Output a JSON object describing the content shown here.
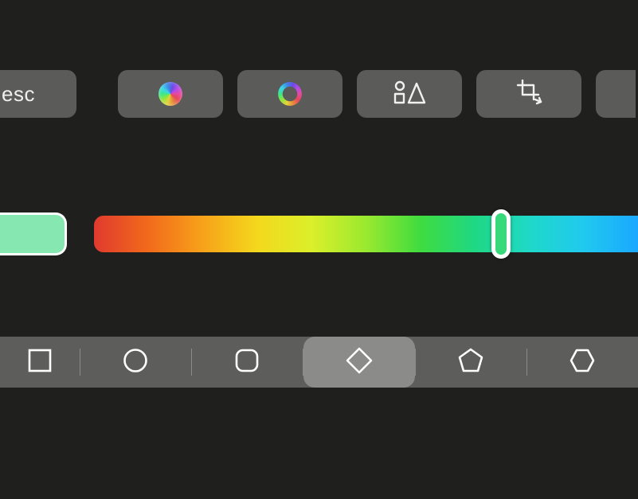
{
  "toolbar": {
    "esc_label": "esc",
    "buttons": [
      {
        "id": "fill-color",
        "icon": "color-disc-icon"
      },
      {
        "id": "stroke-color",
        "icon": "color-ring-icon"
      },
      {
        "id": "shapes",
        "icon": "shapes-icon"
      },
      {
        "id": "crop",
        "icon": "crop-icon"
      }
    ]
  },
  "hue_slider": {
    "swatch_color": "#86e8b0",
    "gradient_stops": [
      "#e03a2e",
      "#f26a1b",
      "#f7a21a",
      "#f4d81c",
      "#dbef2a",
      "#9ae92f",
      "#3fdc3f",
      "#1fd884",
      "#1fd9c8",
      "#20c9ef",
      "#1aa8ff"
    ],
    "thumb_percent": 73,
    "thumb_color": "#38d97a"
  },
  "shapes_bar": {
    "selected_index": 3,
    "shapes": [
      {
        "id": "square",
        "icon": "square-icon"
      },
      {
        "id": "circle",
        "icon": "circle-icon"
      },
      {
        "id": "rounded-square",
        "icon": "rounded-square-icon"
      },
      {
        "id": "diamond",
        "icon": "diamond-icon"
      },
      {
        "id": "pentagon",
        "icon": "pentagon-icon"
      },
      {
        "id": "hexagon",
        "icon": "hexagon-icon"
      }
    ]
  },
  "colors": {
    "bg": "#1f1f1e",
    "button_bg": "#5b5b59",
    "strip_bg": "#5d5d5b",
    "selected_bg": "#8b8b89",
    "stroke": "#f4f4f3"
  }
}
